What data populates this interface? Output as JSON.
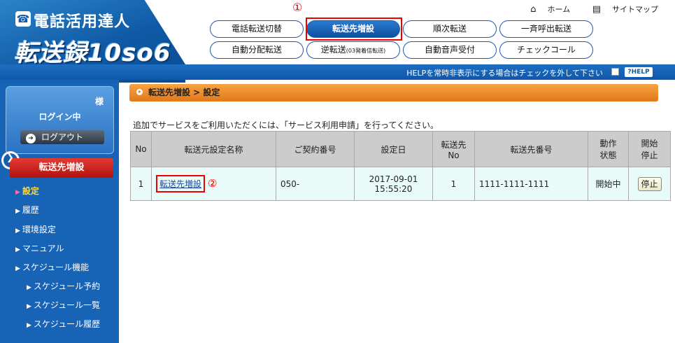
{
  "logo": {
    "title": "電話活用達人",
    "subtitle": "転送録10so6"
  },
  "toplinks": {
    "home": "ホーム",
    "sitemap": "サイトマップ"
  },
  "annotations": {
    "first": "①",
    "second": "②"
  },
  "nav": {
    "row1": [
      "電話転送切替",
      "転送先増設",
      "順次転送",
      "一斉呼出転送"
    ],
    "row2_0": "自動分配転送",
    "row2_1_main": "逆転送",
    "row2_1_small": "(03発着信転送)",
    "row2_2": "自動音声受付",
    "row2_3": "チェックコール",
    "active": "転送先増設"
  },
  "helpbar": {
    "text": "HELPを常時非表示にする場合はチェックを外して下さい",
    "button": "?HELP"
  },
  "sidebar": {
    "user_suffix": "様",
    "status": "ログイン中",
    "logout": "ログアウト",
    "section": "転送先増設",
    "items": [
      "設定",
      "履歴",
      "環境設定",
      "マニュアル",
      "スケジュール機能"
    ],
    "subitems": [
      "スケジュール予約",
      "スケジュール一覧",
      "スケジュール履歴"
    ]
  },
  "main": {
    "breadcrumb": "転送先増設 > 設定",
    "notice": "追加でサービスをご利用いただくには、「サービス利用申請」を行ってください。",
    "table": {
      "headers": [
        "No",
        "転送元設定名称",
        "ご契約番号",
        "設定日",
        "転送先\nNo",
        "転送先番号",
        "動作\n状態",
        "開始\n停止"
      ],
      "row": {
        "no": "1",
        "name": "転送先増設",
        "contract": "050-",
        "date_line1": "2017-09-01",
        "date_line2": "15:55:20",
        "dest_no": "1",
        "dest_number": "1111-1111-1111",
        "status": "開始中",
        "action": "停止"
      }
    }
  }
}
